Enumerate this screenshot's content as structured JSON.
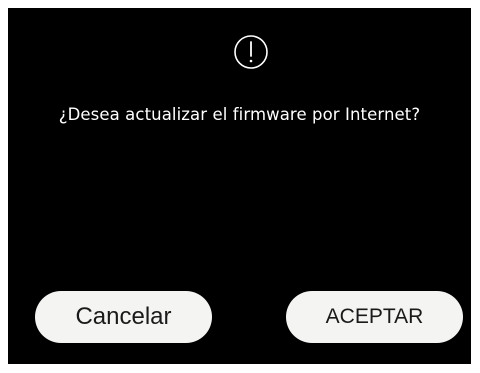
{
  "dialog": {
    "icon": "alert-circle-icon",
    "message": "¿Desea actualizar el firmware por Internet?",
    "cancel_label": "Cancelar",
    "accept_label": "ACEPTAR"
  },
  "colors": {
    "background": "#000000",
    "text": "#ffffff",
    "button_bg": "#f4f4f2",
    "button_text": "#1a1a1a"
  }
}
